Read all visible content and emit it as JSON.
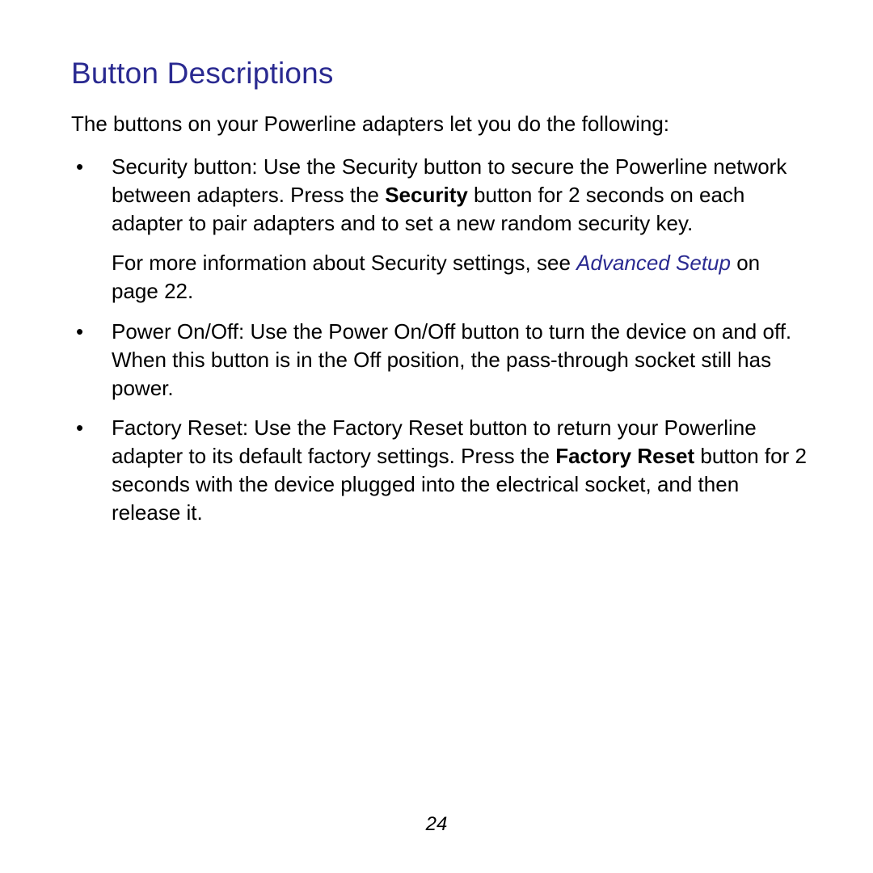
{
  "heading": "Button Descriptions",
  "intro": "The buttons on your Powerline adapters let you do the following:",
  "bullets": {
    "security": {
      "pre": "Security button: Use the Security button to secure the Powerline network between adapters. Press the ",
      "bold": "Security",
      "post": " button for 2 seconds on each adapter to pair adapters and to set a new random security key.",
      "more_pre": "For more information about Security settings, see ",
      "more_link": "Advanced Setup",
      "more_post": " on page 22."
    },
    "power": {
      "text": "Power On/Off: Use the Power On/Off button to turn the device on and off. When this button is in the Off position, the pass-through socket still has power."
    },
    "reset": {
      "pre": "Factory Reset: Use the Factory Reset button to return your Powerline adapter to its default factory settings. Press the ",
      "bold": "Factory Reset",
      "post": " button for 2 seconds with the device plugged into the electrical socket, and then release it."
    }
  },
  "page_number": "24"
}
